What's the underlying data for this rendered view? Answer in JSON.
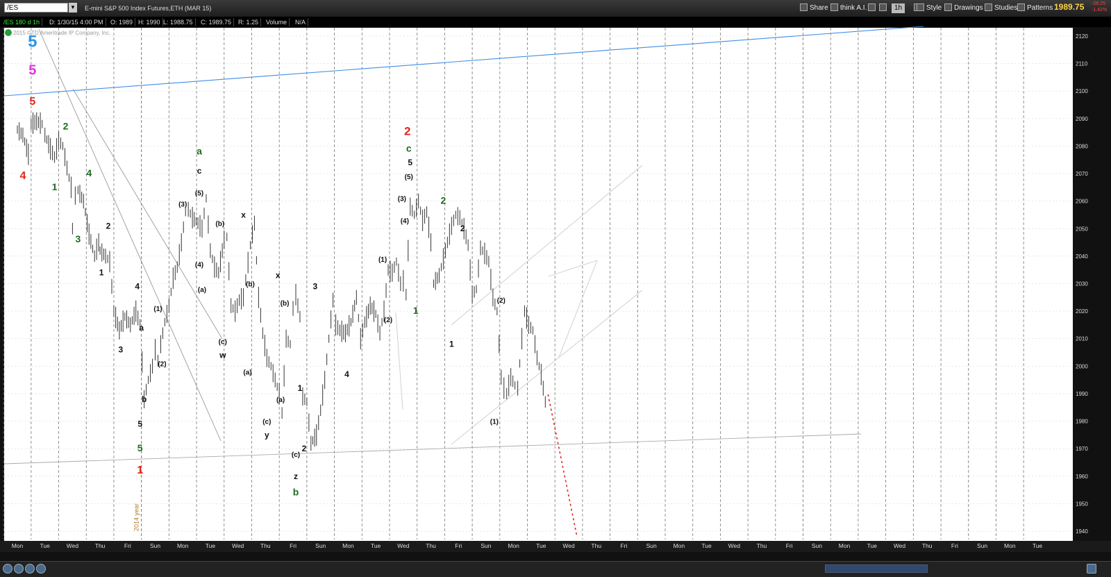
{
  "toolbar": {
    "symbol": "/ES",
    "description": "E-mini S&P 500 Index Futures,ETH (MAR 15)",
    "share": "Share",
    "think": "think A.I.",
    "timeframe": "1h",
    "style": "Style",
    "drawings": "Drawings",
    "studies": "Studies",
    "patterns": "Patterns",
    "last_price": "1989.75",
    "change": "-28.25",
    "change_pct": "-1.42%"
  },
  "infobar": {
    "study": "/ES 180 d 1h",
    "date": "D: 1/30/15 4:00 PM",
    "open": "O: 1989",
    "high": "H: 1990",
    "low": "L: 1988.75",
    "close": "C: 1989.75",
    "range": "R: 1.25",
    "volume": "Volume",
    "volume_value": "N/A"
  },
  "copyright": "2015 ©TD Ameritrade IP Company, Inc.",
  "colors": {
    "background": "#ffffff",
    "bar": "#333333",
    "grid": "#555555",
    "blue_line": "#3d8ee6",
    "red": "#e3241b",
    "green": "#1e6b1e",
    "magenta": "#e233e2",
    "label_blue": "#2f95ee"
  },
  "chart_data": {
    "type": "line",
    "y_axis": {
      "min": 1937,
      "max": 2123,
      "ticks": [
        2120,
        2110,
        2100,
        2090,
        2080,
        2070,
        2060,
        2050,
        2040,
        2030,
        2020,
        2010,
        2000,
        1990,
        1980,
        1970,
        1960,
        1950,
        1940
      ]
    },
    "x_axis": {
      "ticks": [
        "Mon",
        "Tue",
        "Wed",
        "Thu",
        "Fri",
        "Sun",
        "Mon",
        "Tue",
        "Wed",
        "Thu",
        "Fri",
        "Sun",
        "Mon",
        "Tue",
        "Wed",
        "Thu",
        "Fri",
        "Sun",
        "Mon",
        "Tue",
        "Wed",
        "Thu",
        "Fri",
        "Sun",
        "Mon",
        "Tue",
        "Wed",
        "Thu",
        "Fri",
        "Sun",
        "Mon",
        "Tue",
        "Wed",
        "Thu",
        "Fri",
        "Sun",
        "Mon",
        "Tue"
      ],
      "year_marker": "2014 year"
    },
    "series": [
      {
        "values": [
          [
            0,
            2086
          ],
          [
            0.2,
            2084
          ],
          [
            0.4,
            2077
          ],
          [
            0.5,
            2088
          ],
          [
            0.7,
            2089
          ],
          [
            0.9,
            2088
          ],
          [
            1.0,
            2084
          ],
          [
            1.2,
            2079
          ],
          [
            1.35,
            2076
          ],
          [
            1.5,
            2082
          ],
          [
            1.65,
            2080
          ],
          [
            1.8,
            2072
          ],
          [
            1.95,
            2065
          ],
          [
            2.0,
            2050
          ],
          [
            2.1,
            2062
          ],
          [
            2.2,
            2064
          ],
          [
            2.4,
            2060
          ],
          [
            2.6,
            2048
          ],
          [
            2.8,
            2040
          ],
          [
            2.95,
            2045
          ],
          [
            3.0,
            2042
          ],
          [
            3.2,
            2040
          ],
          [
            3.35,
            2038
          ],
          [
            3.5,
            2020
          ],
          [
            3.7,
            2013
          ],
          [
            3.9,
            2018
          ],
          [
            4.1,
            2015
          ],
          [
            4.3,
            2020
          ],
          [
            4.45,
            2015
          ],
          [
            4.6,
            1988
          ],
          [
            4.75,
            1995
          ],
          [
            4.9,
            2000
          ],
          [
            5.0,
            2006
          ],
          [
            5.1,
            2002
          ],
          [
            5.2,
            2008
          ],
          [
            5.35,
            2016
          ],
          [
            5.5,
            2022
          ],
          [
            5.65,
            2032
          ],
          [
            5.8,
            2036
          ],
          [
            5.95,
            2045
          ],
          [
            6.1,
            2056
          ],
          [
            6.2,
            2057
          ],
          [
            6.35,
            2054
          ],
          [
            6.55,
            2052
          ],
          [
            6.7,
            2050
          ],
          [
            6.85,
            2061
          ],
          [
            7.0,
            2042
          ],
          [
            7.15,
            2036
          ],
          [
            7.3,
            2034
          ],
          [
            7.5,
            2046
          ],
          [
            7.6,
            2047
          ],
          [
            7.75,
            2022
          ],
          [
            7.9,
            2020
          ],
          [
            8.05,
            2024
          ],
          [
            8.2,
            2025
          ],
          [
            8.45,
            2044
          ],
          [
            8.6,
            2052
          ],
          [
            8.75,
            2025
          ],
          [
            8.9,
            2012
          ],
          [
            9.05,
            2003
          ],
          [
            9.2,
            2000
          ],
          [
            9.35,
            1995
          ],
          [
            9.5,
            1990
          ],
          [
            9.6,
            1983
          ],
          [
            9.75,
            2010
          ],
          [
            9.9,
            2008
          ],
          [
            10.0,
            2021
          ],
          [
            10.1,
            2026
          ],
          [
            10.25,
            2018
          ],
          [
            10.35,
            1989
          ],
          [
            10.5,
            1987
          ],
          [
            10.65,
            1972
          ],
          [
            10.85,
            1975
          ],
          [
            11.0,
            1984
          ],
          [
            11.15,
            1995
          ],
          [
            11.3,
            2010
          ],
          [
            11.45,
            2024
          ],
          [
            11.55,
            2015
          ],
          [
            11.7,
            2013
          ],
          [
            11.9,
            2012
          ],
          [
            12.1,
            2016
          ],
          [
            12.3,
            2025
          ],
          [
            12.45,
            2010
          ],
          [
            12.6,
            2016
          ],
          [
            12.8,
            2022
          ],
          [
            13.0,
            2019
          ],
          [
            13.15,
            2012
          ],
          [
            13.3,
            2020
          ],
          [
            13.45,
            2035
          ],
          [
            13.6,
            2034
          ],
          [
            13.75,
            2038
          ],
          [
            13.9,
            2030
          ],
          [
            14.0,
            2031
          ],
          [
            14.1,
            2026
          ],
          [
            14.25,
            2058
          ],
          [
            14.4,
            2055
          ],
          [
            14.55,
            2060
          ],
          [
            14.7,
            2053
          ],
          [
            14.85,
            2056
          ],
          [
            15.0,
            2045
          ],
          [
            15.1,
            2030
          ],
          [
            15.3,
            2033
          ],
          [
            15.45,
            2039
          ],
          [
            15.6,
            2045
          ],
          [
            15.75,
            2051
          ],
          [
            15.9,
            2055
          ],
          [
            16.05,
            2054
          ],
          [
            16.2,
            2050
          ],
          [
            16.35,
            2044
          ],
          [
            16.5,
            2026
          ],
          [
            16.65,
            2028
          ],
          [
            16.8,
            2043
          ],
          [
            16.95,
            2041
          ],
          [
            17.1,
            2038
          ],
          [
            17.25,
            2025
          ],
          [
            17.4,
            2020
          ],
          [
            17.55,
            1996
          ],
          [
            17.65,
            1992
          ],
          [
            17.75,
            1990
          ],
          [
            17.9,
            1996
          ],
          [
            18.05,
            1993
          ],
          [
            18.15,
            1992
          ],
          [
            18.3,
            2010
          ],
          [
            18.4,
            2020
          ],
          [
            18.55,
            2015
          ],
          [
            18.7,
            2013
          ],
          [
            18.85,
            2003
          ],
          [
            19.0,
            1997
          ],
          [
            19.15,
            1987
          ],
          [
            19.25,
            1989.75
          ]
        ]
      }
    ],
    "projection": [
      [
        19.25,
        1989.75
      ],
      [
        20.3,
        1938
      ]
    ],
    "wave_labels": [
      {
        "t": "5",
        "x": 0.55,
        "y": 2116,
        "c": "label_blue",
        "s": 24
      },
      {
        "t": "5",
        "x": 0.55,
        "y": 2106,
        "c": "magenta",
        "s": 20
      },
      {
        "t": "5",
        "x": 0.55,
        "y": 2095,
        "c": "red",
        "s": 16
      },
      {
        "t": "4",
        "x": 0.2,
        "y": 2068,
        "c": "red",
        "s": 16
      },
      {
        "t": "2",
        "x": 1.75,
        "y": 2086,
        "c": "green",
        "s": 14
      },
      {
        "t": "1",
        "x": 1.35,
        "y": 2064,
        "c": "green",
        "s": 14
      },
      {
        "t": "4",
        "x": 2.6,
        "y": 2069,
        "c": "green",
        "s": 14
      },
      {
        "t": "3",
        "x": 2.2,
        "y": 2045,
        "c": "green",
        "s": 14
      },
      {
        "t": "2",
        "x": 3.3,
        "y": 2050,
        "c": "dark",
        "s": 12
      },
      {
        "t": "1",
        "x": 3.05,
        "y": 2033,
        "c": "dark",
        "s": 12
      },
      {
        "t": "4",
        "x": 4.35,
        "y": 2028,
        "c": "dark",
        "s": 12
      },
      {
        "t": "3",
        "x": 3.75,
        "y": 2005,
        "c": "dark",
        "s": 12
      },
      {
        "t": "a",
        "x": 4.5,
        "y": 2013,
        "c": "dark",
        "s": 12
      },
      {
        "t": "b",
        "x": 4.6,
        "y": 1987,
        "c": "dark",
        "s": 12
      },
      {
        "t": "5",
        "x": 4.45,
        "y": 1978,
        "c": "dark",
        "s": 12
      },
      {
        "t": "5",
        "x": 4.45,
        "y": 1969,
        "c": "green",
        "s": 14
      },
      {
        "t": "1",
        "x": 4.45,
        "y": 1961,
        "c": "red",
        "s": 16
      },
      {
        "t": "(1)",
        "x": 5.1,
        "y": 2020,
        "c": "dark",
        "s": 10
      },
      {
        "t": "(2)",
        "x": 5.25,
        "y": 2000,
        "c": "dark",
        "s": 10
      },
      {
        "t": "(3)",
        "x": 6.0,
        "y": 2058,
        "c": "dark",
        "s": 10
      },
      {
        "t": "(5)",
        "x": 6.6,
        "y": 2062,
        "c": "dark",
        "s": 10
      },
      {
        "t": "c",
        "x": 6.6,
        "y": 2070,
        "c": "dark",
        "s": 12
      },
      {
        "t": "a",
        "x": 6.6,
        "y": 2077,
        "c": "green",
        "s": 14
      },
      {
        "t": "(4)",
        "x": 6.6,
        "y": 2036,
        "c": "dark",
        "s": 10
      },
      {
        "t": "(a)",
        "x": 6.7,
        "y": 2027,
        "c": "dark",
        "s": 10
      },
      {
        "t": "(b)",
        "x": 7.35,
        "y": 2051,
        "c": "dark",
        "s": 10
      },
      {
        "t": "(c)",
        "x": 7.45,
        "y": 2008,
        "c": "dark",
        "s": 10
      },
      {
        "t": "w",
        "x": 7.45,
        "y": 2003,
        "c": "dark",
        "s": 12
      },
      {
        "t": "x",
        "x": 8.2,
        "y": 2054,
        "c": "dark",
        "s": 12
      },
      {
        "t": "(b)",
        "x": 8.45,
        "y": 2029,
        "c": "dark",
        "s": 10
      },
      {
        "t": "(a)",
        "x": 8.35,
        "y": 1997,
        "c": "dark",
        "s": 10
      },
      {
        "t": "(c)",
        "x": 9.05,
        "y": 1979,
        "c": "dark",
        "s": 10
      },
      {
        "t": "y",
        "x": 9.05,
        "y": 1974,
        "c": "dark",
        "s": 12
      },
      {
        "t": "x",
        "x": 9.45,
        "y": 2032,
        "c": "dark",
        "s": 12
      },
      {
        "t": "(b)",
        "x": 9.7,
        "y": 2022,
        "c": "dark",
        "s": 10
      },
      {
        "t": "(a)",
        "x": 9.55,
        "y": 1987,
        "c": "dark",
        "s": 10
      },
      {
        "t": "(c)",
        "x": 10.1,
        "y": 1967,
        "c": "dark",
        "s": 10
      },
      {
        "t": "z",
        "x": 10.1,
        "y": 1959,
        "c": "dark",
        "s": 12
      },
      {
        "t": "b",
        "x": 10.1,
        "y": 1953,
        "c": "green",
        "s": 14
      },
      {
        "t": "1",
        "x": 10.25,
        "y": 1991,
        "c": "dark",
        "s": 12
      },
      {
        "t": "2",
        "x": 10.4,
        "y": 1969,
        "c": "dark",
        "s": 12
      },
      {
        "t": "3",
        "x": 10.8,
        "y": 2028,
        "c": "dark",
        "s": 12
      },
      {
        "t": "4",
        "x": 11.95,
        "y": 1996,
        "c": "dark",
        "s": 12
      },
      {
        "t": "(1)",
        "x": 13.25,
        "y": 2038,
        "c": "dark",
        "s": 10
      },
      {
        "t": "(2)",
        "x": 13.45,
        "y": 2016,
        "c": "dark",
        "s": 10
      },
      {
        "t": "(3)",
        "x": 13.95,
        "y": 2060,
        "c": "dark",
        "s": 10
      },
      {
        "t": "(4)",
        "x": 14.05,
        "y": 2052,
        "c": "dark",
        "s": 10
      },
      {
        "t": "(5)",
        "x": 14.2,
        "y": 2068,
        "c": "dark",
        "s": 10
      },
      {
        "t": "5",
        "x": 14.25,
        "y": 2073,
        "c": "dark",
        "s": 12
      },
      {
        "t": "c",
        "x": 14.2,
        "y": 2078,
        "c": "green",
        "s": 14
      },
      {
        "t": "2",
        "x": 14.15,
        "y": 2084,
        "c": "red",
        "s": 17
      },
      {
        "t": "1",
        "x": 14.45,
        "y": 2019,
        "c": "green",
        "s": 14
      },
      {
        "t": "2",
        "x": 15.45,
        "y": 2059,
        "c": "green",
        "s": 14
      },
      {
        "t": "1",
        "x": 15.75,
        "y": 2007,
        "c": "dark",
        "s": 12
      },
      {
        "t": "2",
        "x": 16.15,
        "y": 2049,
        "c": "dark",
        "s": 12
      },
      {
        "t": "(2)",
        "x": 17.55,
        "y": 2023,
        "c": "dark",
        "s": 10
      },
      {
        "t": "(1)",
        "x": 17.3,
        "y": 1979,
        "c": "dark",
        "s": 10
      }
    ]
  }
}
